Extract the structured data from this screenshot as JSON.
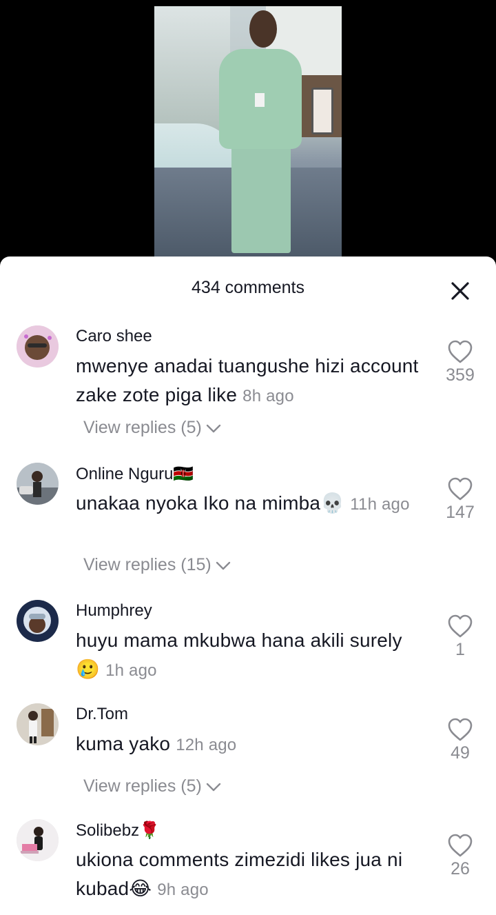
{
  "sheet": {
    "comments_count": "434 comments",
    "close_icon": "close-icon"
  },
  "colors": {
    "text_primary": "#161823",
    "text_secondary": "#8a8b91",
    "sheet_background": "#ffffff",
    "video_background": "#000000"
  },
  "comments": [
    {
      "username": "Caro shee",
      "text": "mwenye anadai tuangushe hizi account zake zote piga like",
      "time": "8h ago",
      "likes": "359",
      "replies": "View replies (5)"
    },
    {
      "username": "Online Nguru🇰🇪",
      "text": "unakaa nyoka Iko na mimba💀",
      "time": "11h ago",
      "likes": "147",
      "replies": "View replies (15)"
    },
    {
      "username": "Humphrey",
      "text": "huyu mama mkubwa hana akili surely 🥲",
      "time": "1h ago",
      "likes": "1",
      "replies": ""
    },
    {
      "username": "Dr.Tom",
      "text": "kuma yako",
      "time": "12h ago",
      "likes": "49",
      "replies": "View replies (5)"
    },
    {
      "username": "Solibebz🌹",
      "text": "ukiona comments zimezidi likes jua ni kubad😂",
      "time": "9h ago",
      "likes": "26",
      "replies": ""
    }
  ]
}
